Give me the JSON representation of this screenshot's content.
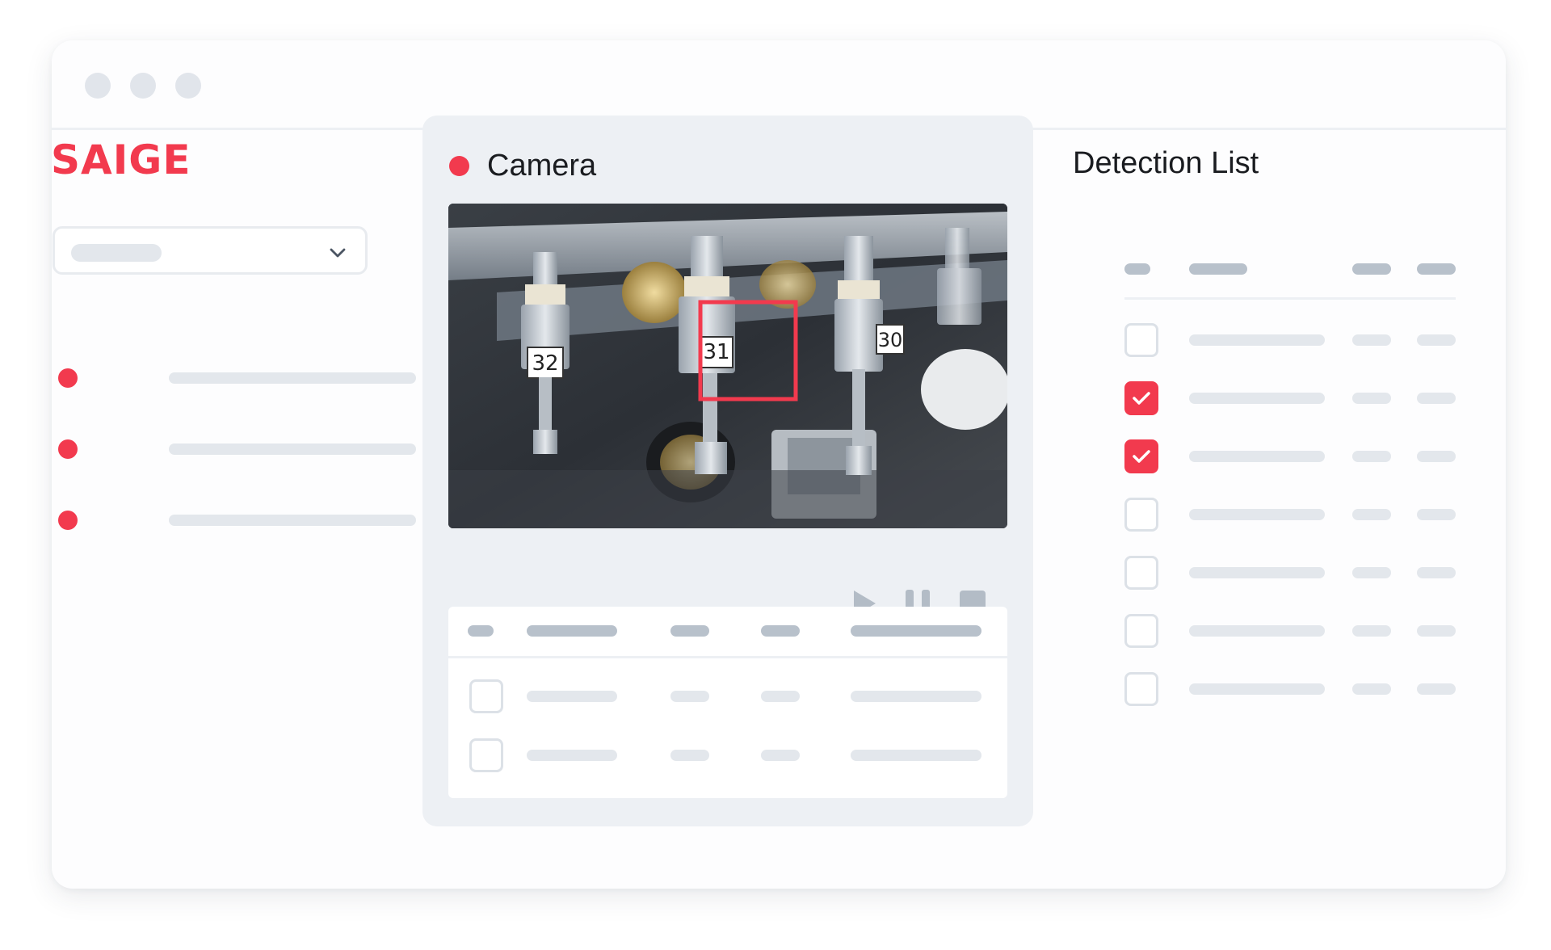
{
  "brand": {
    "logo_text": "SAIGE",
    "accent_color": "#f23a4e"
  },
  "window": {
    "controls": [
      "close",
      "minimize",
      "maximize"
    ]
  },
  "sidebar": {
    "dropdown": {
      "icon": "chevron-down-icon"
    },
    "items": [
      {
        "status": "red-dot"
      },
      {
        "status": "red-dot"
      },
      {
        "status": "red-dot"
      }
    ]
  },
  "camera": {
    "title": "Camera",
    "status": "live",
    "labels": [
      "32",
      "31",
      "30"
    ],
    "detected_label": "31",
    "controls": [
      "play-icon",
      "pause-icon",
      "stop-icon"
    ]
  },
  "camera_table": {
    "rows": [
      {
        "checked": false
      },
      {
        "checked": false
      }
    ]
  },
  "detection_list": {
    "title": "Detection List",
    "rows": [
      {
        "checked": false
      },
      {
        "checked": true
      },
      {
        "checked": true
      },
      {
        "checked": false
      },
      {
        "checked": false
      },
      {
        "checked": false
      },
      {
        "checked": false
      }
    ]
  }
}
